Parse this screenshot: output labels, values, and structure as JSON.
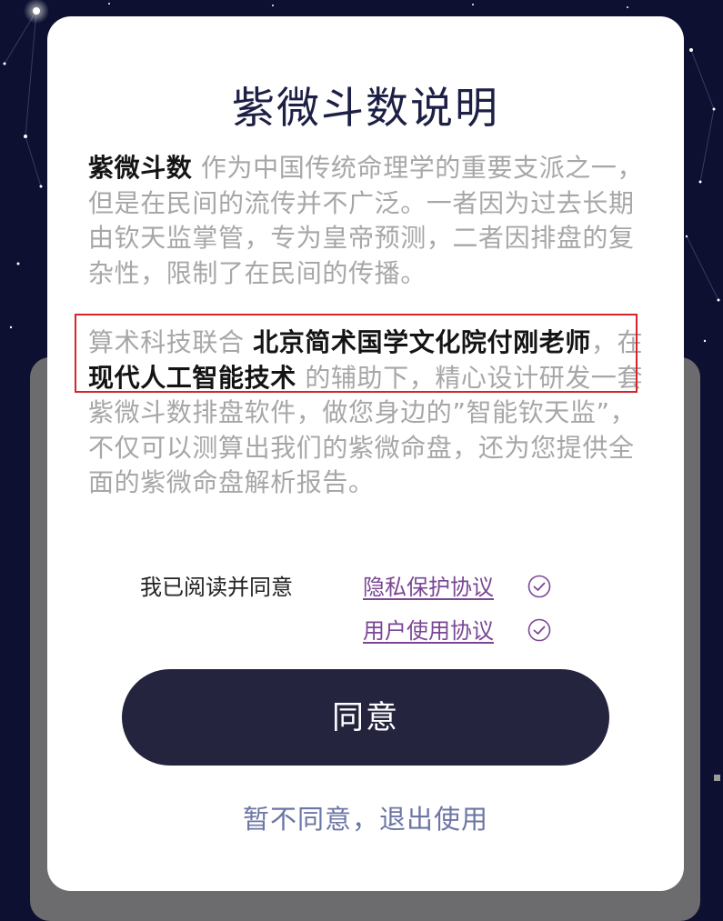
{
  "dialog": {
    "title": "紫微斗数说明",
    "intro": {
      "bold_lead": "紫微斗数",
      "text": " 作为中国传统命理学的重要支派之一，但是在民间的流传并不广泛。一者因为过去长期由钦天监掌管，专为皇帝预测，二者因排盘的复杂性，限制了在民间的传播。"
    },
    "detail": {
      "part1": "算术科技联合 ",
      "bold1": "北京简术国学文化院付刚老师",
      "part2": "，在 ",
      "bold2": "现代人工智能技术",
      "part3": " 的辅助下，精心设计研发一套紫微斗数排盘软件，做您身边的”智能钦天监”，不仅可以测算出我们的紫微命盘，还为您提供全面的紫微命盘解析报告。"
    },
    "agreement": {
      "label": "我已阅读并同意",
      "privacy_link": "隐私保护协议",
      "user_link": "用户使用协议"
    },
    "agree_button": "同意",
    "decline_link": "暂不同意，退出使用"
  },
  "colors": {
    "background": "#0d1030",
    "title": "#1d2045",
    "button": "#24243f",
    "link": "#7a4794",
    "decline": "#6c76a5",
    "highlight_border": "#d5252b"
  },
  "icons": {
    "check": "check-circle-icon"
  }
}
